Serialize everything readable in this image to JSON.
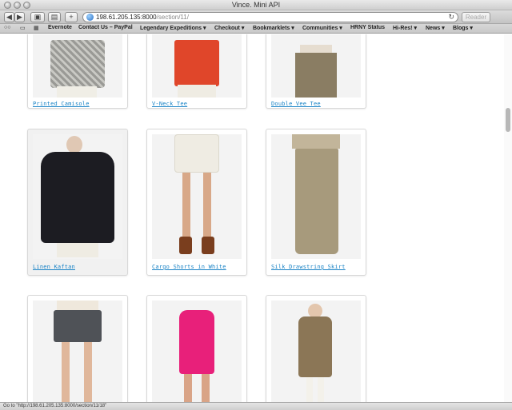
{
  "window": {
    "title": "Vince. Mini API"
  },
  "toolbar": {
    "back_icon": "back-arrow-icon",
    "forward_icon": "forward-arrow-icon",
    "url_host": "198.61.205.135:8000",
    "url_path": "/section/11/",
    "reader_label": "Reader",
    "new_tab_label": "+"
  },
  "bookmarks": [
    {
      "label": "Evernote"
    },
    {
      "label": "Contact Us – PayPal"
    },
    {
      "label": "Legendary Expeditions ▾"
    },
    {
      "label": "Checkout ▾"
    },
    {
      "label": "Bookmarklets ▾"
    },
    {
      "label": "Communities ▾"
    },
    {
      "label": "HRNY Status"
    },
    {
      "label": "Hi-Res! ▾"
    },
    {
      "label": "News ▾"
    },
    {
      "label": "Blogs ▾"
    }
  ],
  "products": [
    {
      "name": "Printed Camisole",
      "color": "#b7b7b1"
    },
    {
      "name": "V-Neck Tee",
      "color": "#e0462a"
    },
    {
      "name": "Double Vee Tee",
      "color": "#8a7d63"
    },
    {
      "name": "Linen Kaftan",
      "color": "#1c1c22"
    },
    {
      "name": "Cargo Shorts in White",
      "color": "#efece3"
    },
    {
      "name": "Silk Drawstring Skirt",
      "color": "#a79a7c"
    },
    {
      "name": "",
      "color": "#4f5257"
    },
    {
      "name": "",
      "color": "#e8207a"
    },
    {
      "name": "",
      "color": "#8b7656"
    }
  ],
  "status": {
    "text": "Go to \"http://198.61.205.135:8000/section/11/18\""
  }
}
